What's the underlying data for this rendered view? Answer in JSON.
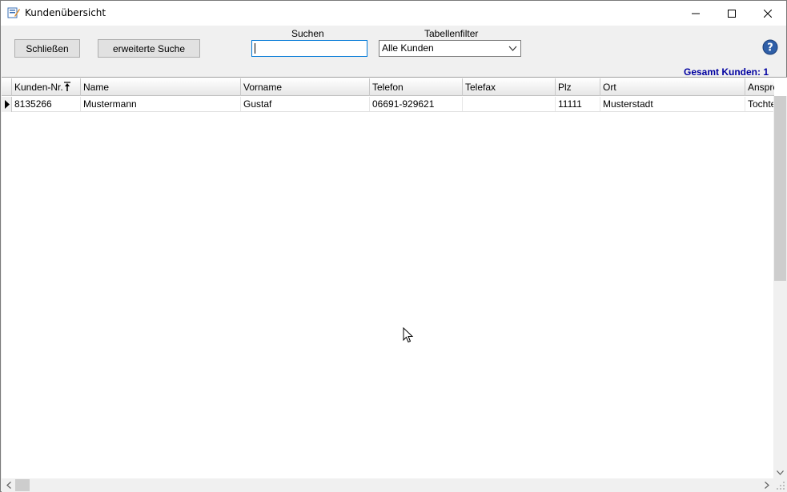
{
  "window": {
    "title": "Kundenübersicht",
    "icon": "app-icon",
    "controls": {
      "minimize": "minimize-icon",
      "maximize": "maximize-icon",
      "close": "close-icon"
    }
  },
  "toolbar": {
    "close_label": "Schließen",
    "advanced_search_label": "erweiterte Suche",
    "search_label": "Suchen",
    "search_value": "",
    "filter_label": "Tabellenfilter",
    "filter_value": "Alle Kunden",
    "help_icon": "help-icon"
  },
  "summary": {
    "total": "Gesamt Kunden:  1"
  },
  "table": {
    "columns": [
      "Kunden-Nr.",
      "Name",
      "Vorname",
      "Telefon",
      "Telefax",
      "Plz",
      "Ort",
      "Anspre"
    ],
    "rows": [
      [
        "8135266",
        "Mustermann",
        "Gustaf",
        "06691-929621",
        "",
        "11111",
        "Musterstadt",
        "Tochte"
      ]
    ]
  },
  "colors": {
    "accent": "#0078d7",
    "total_text": "#0000a0"
  }
}
